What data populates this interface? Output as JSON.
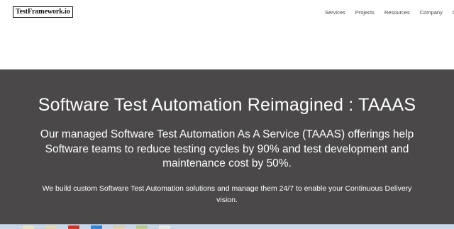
{
  "header": {
    "logo_text": "TestFramework.io",
    "nav": [
      "Services",
      "Projects",
      "Resources",
      "Company",
      "C"
    ]
  },
  "hero": {
    "title": "Software Test Automation Reimagined : TAAAS",
    "lead": "Our managed Software Test Automation As A Service (TAAAS) offerings help Software teams to reduce testing cycles by 90% and test development and maintenance cost by 50%.",
    "sub": "We build custom Software Test Automation solutions and manage them 24/7 to enable your Continuous Delivery vision."
  },
  "colors": {
    "hero_bg": "#4a4848",
    "taskbar": "#c8d6e6"
  }
}
